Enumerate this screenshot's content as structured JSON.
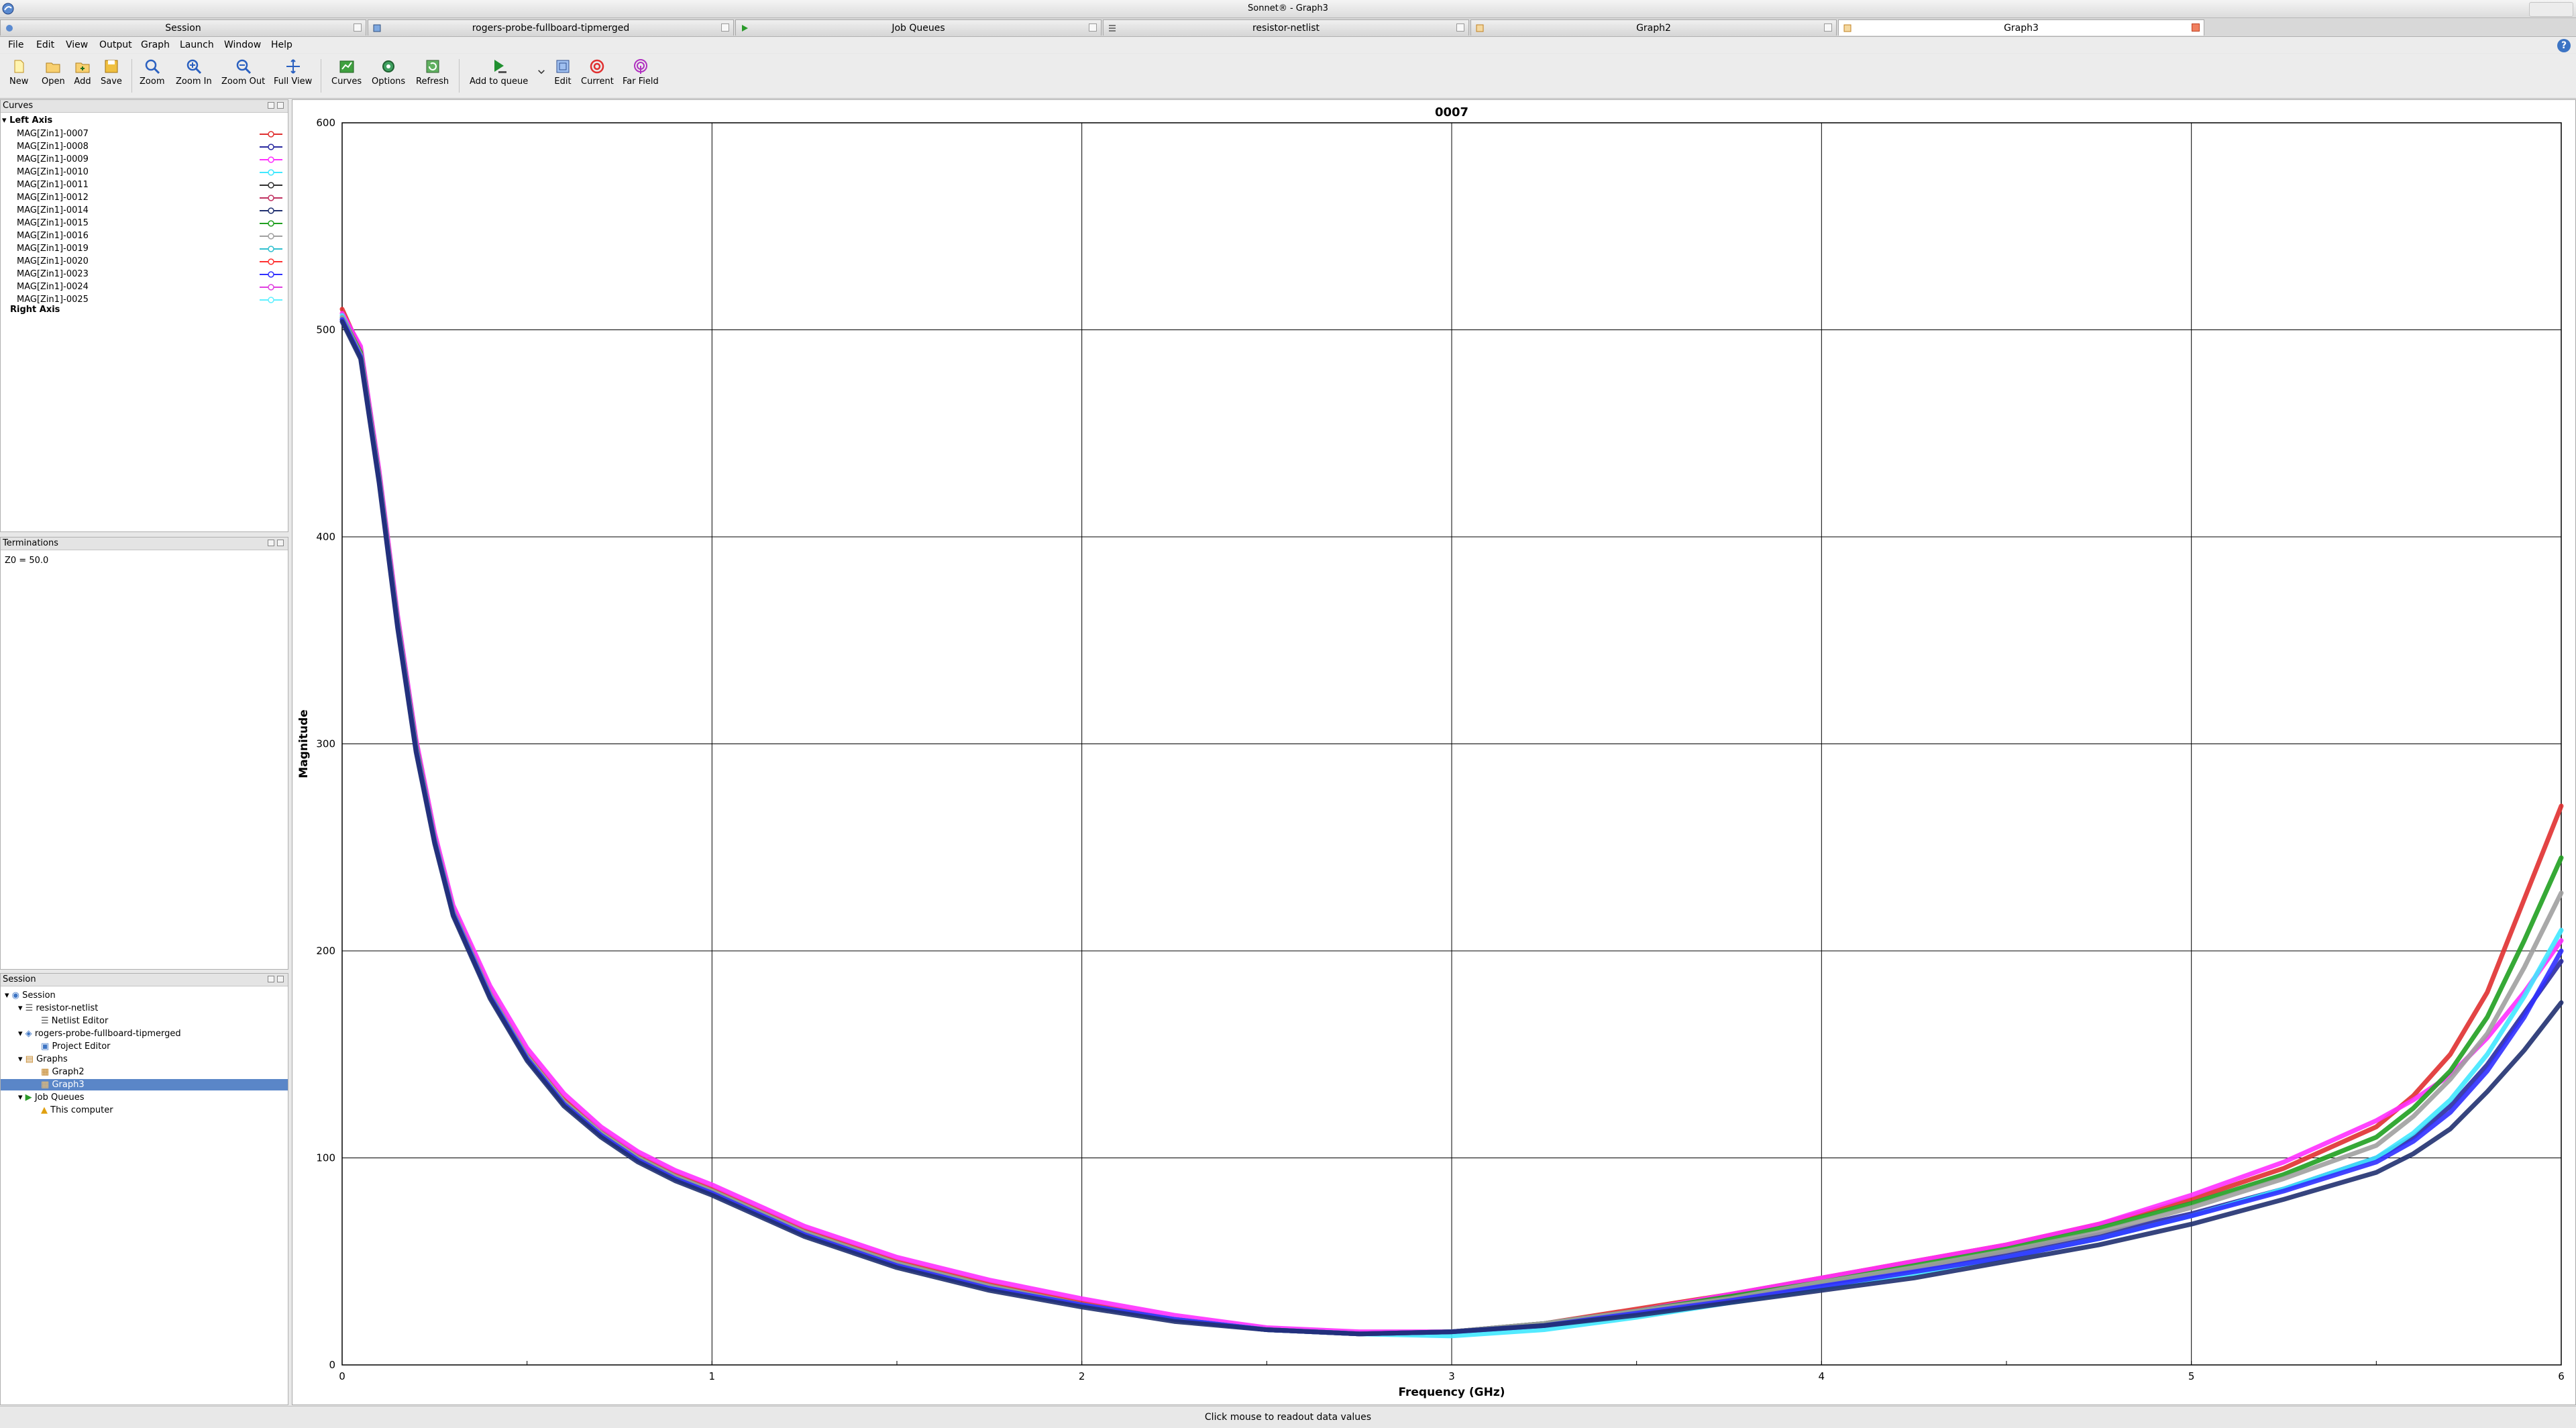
{
  "window": {
    "title": "Sonnet® - Graph3"
  },
  "tabs": [
    {
      "label": "Session",
      "active": false
    },
    {
      "label": "rogers-probe-fullboard-tipmerged",
      "active": false
    },
    {
      "label": "Job Queues",
      "active": false
    },
    {
      "label": "resistor-netlist",
      "active": false
    },
    {
      "label": "Graph2",
      "active": false
    },
    {
      "label": "Graph3",
      "active": true
    }
  ],
  "menu": [
    "File",
    "Edit",
    "View",
    "Output",
    "Graph",
    "Launch",
    "Window",
    "Help"
  ],
  "toolbar": {
    "new": "New",
    "open": "Open",
    "add": "Add",
    "save": "Save",
    "zoom": "Zoom",
    "zoom_in": "Zoom In",
    "zoom_out": "Zoom Out",
    "full_view": "Full View",
    "curves": "Curves",
    "options": "Options",
    "refresh": "Refresh",
    "add_to_queue": "Add to queue",
    "edit": "Edit",
    "current": "Current",
    "far_field": "Far Field"
  },
  "curves_panel": {
    "title": "Curves",
    "left_axis": "Left Axis",
    "right_axis": "Right Axis",
    "items": [
      {
        "label": "MAG[Zin1]-0007",
        "color": "#e03030"
      },
      {
        "label": "MAG[Zin1]-0008",
        "color": "#2a2aa0"
      },
      {
        "label": "MAG[Zin1]-0009",
        "color": "#ff30ff"
      },
      {
        "label": "MAG[Zin1]-0010",
        "color": "#40e8ff"
      },
      {
        "label": "MAG[Zin1]-0011",
        "color": "#303030"
      },
      {
        "label": "MAG[Zin1]-0012",
        "color": "#c03060"
      },
      {
        "label": "MAG[Zin1]-0014",
        "color": "#203070"
      },
      {
        "label": "MAG[Zin1]-0015",
        "color": "#20a020"
      },
      {
        "label": "MAG[Zin1]-0016",
        "color": "#a0a0a0"
      },
      {
        "label": "MAG[Zin1]-0019",
        "color": "#30c0d0"
      },
      {
        "label": "MAG[Zin1]-0020",
        "color": "#ff3030"
      },
      {
        "label": "MAG[Zin1]-0023",
        "color": "#3030ff"
      },
      {
        "label": "MAG[Zin1]-0024",
        "color": "#e040e0"
      },
      {
        "label": "MAG[Zin1]-0025",
        "color": "#60f0ff"
      }
    ]
  },
  "terminations_panel": {
    "title": "Terminations",
    "text": "Z0 = 50.0"
  },
  "session_panel": {
    "title": "Session",
    "root": "Session",
    "resistor_netlist": "resistor-netlist",
    "netlist_editor": "Netlist Editor",
    "rogers": "rogers-probe-fullboard-tipmerged",
    "project_editor": "Project Editor",
    "graphs": "Graphs",
    "graph2": "Graph2",
    "graph3": "Graph3",
    "job_queues": "Job Queues",
    "this_computer": "This computer"
  },
  "status": {
    "text": "Click mouse to readout data values"
  },
  "chart_data": {
    "type": "line",
    "title": "0007",
    "xlabel": "Frequency (GHz)",
    "ylabel": "Magnitude",
    "xlim": [
      0,
      6
    ],
    "ylim": [
      0,
      600
    ],
    "xticks": [
      0,
      1,
      2,
      3,
      4,
      5,
      6
    ],
    "yticks": [
      0,
      100,
      200,
      300,
      400,
      500,
      600
    ],
    "grid": true,
    "x": [
      0,
      0.05,
      0.1,
      0.15,
      0.2,
      0.25,
      0.3,
      0.4,
      0.5,
      0.6,
      0.7,
      0.8,
      0.9,
      1.0,
      1.25,
      1.5,
      1.75,
      2.0,
      2.25,
      2.5,
      2.75,
      3.0,
      3.25,
      3.5,
      3.75,
      4.0,
      4.25,
      4.5,
      4.75,
      5.0,
      5.25,
      5.5,
      5.6,
      5.7,
      5.8,
      5.9,
      6.0
    ],
    "series": [
      {
        "name": "MAG[Zin1]-0007",
        "color": "#e03030",
        "values": [
          510,
          490,
          430,
          360,
          300,
          255,
          220,
          180,
          150,
          128,
          113,
          101,
          92,
          85,
          65,
          50,
          39,
          30,
          22,
          17,
          15,
          16,
          20,
          27,
          34,
          42,
          50,
          58,
          68,
          80,
          95,
          115,
          130,
          150,
          180,
          225,
          270
        ]
      },
      {
        "name": "MAG[Zin1]-0008",
        "color": "#2a2aa0",
        "values": [
          505,
          487,
          427,
          357,
          297,
          253,
          218,
          178,
          148,
          126,
          111,
          99,
          90,
          83,
          63,
          48,
          37,
          29,
          22,
          17,
          15,
          16,
          20,
          26,
          32,
          39,
          46,
          54,
          63,
          73,
          85,
          100,
          110,
          125,
          145,
          170,
          195
        ]
      },
      {
        "name": "MAG[Zin1]-0009",
        "color": "#ff30ff",
        "values": [
          508,
          492,
          432,
          362,
          302,
          257,
          222,
          183,
          153,
          131,
          115,
          103,
          94,
          87,
          67,
          52,
          41,
          32,
          24,
          18,
          16,
          16,
          20,
          26,
          34,
          42,
          50,
          58,
          68,
          82,
          98,
          118,
          128,
          140,
          158,
          180,
          205
        ]
      },
      {
        "name": "MAG[Zin1]-0010",
        "color": "#40e8ff",
        "values": [
          507,
          488,
          428,
          358,
          298,
          254,
          219,
          179,
          149,
          127,
          112,
          100,
          91,
          84,
          64,
          49,
          38,
          29,
          22,
          17,
          15,
          14,
          17,
          23,
          30,
          37,
          44,
          52,
          61,
          72,
          85,
          100,
          112,
          128,
          150,
          178,
          210
        ]
      },
      {
        "name": "MAG[Zin1]-0015",
        "color": "#20a020",
        "values": [
          506,
          489,
          429,
          359,
          299,
          254,
          219,
          179,
          149,
          127,
          112,
          100,
          91,
          84,
          64,
          49,
          38,
          29,
          22,
          17,
          15,
          16,
          20,
          26,
          33,
          40,
          48,
          56,
          66,
          78,
          92,
          110,
          124,
          142,
          168,
          205,
          245
        ]
      },
      {
        "name": "MAG[Zin1]-0016",
        "color": "#a0a0a0",
        "values": [
          506,
          488,
          428,
          358,
          298,
          254,
          219,
          179,
          149,
          127,
          112,
          100,
          91,
          84,
          64,
          49,
          38,
          29,
          22,
          17,
          15,
          16,
          20,
          26,
          32,
          40,
          47,
          55,
          64,
          76,
          90,
          106,
          120,
          138,
          160,
          192,
          228
        ]
      },
      {
        "name": "MAG[Zin1]-0023",
        "color": "#3030ff",
        "values": [
          505,
          487,
          427,
          357,
          297,
          253,
          218,
          178,
          148,
          126,
          111,
          99,
          90,
          83,
          63,
          48,
          37,
          29,
          22,
          17,
          15,
          16,
          19,
          25,
          31,
          38,
          45,
          52,
          61,
          72,
          84,
          98,
          108,
          122,
          142,
          168,
          200
        ]
      },
      {
        "name": "MAG[Zin1]-0014",
        "color": "#203070",
        "values": [
          504,
          486,
          426,
          356,
          296,
          252,
          217,
          177,
          147,
          125,
          110,
          98,
          89,
          82,
          62,
          47,
          36,
          28,
          21,
          17,
          15,
          16,
          19,
          24,
          30,
          36,
          42,
          50,
          58,
          68,
          80,
          93,
          102,
          114,
          132,
          152,
          175
        ]
      }
    ]
  }
}
